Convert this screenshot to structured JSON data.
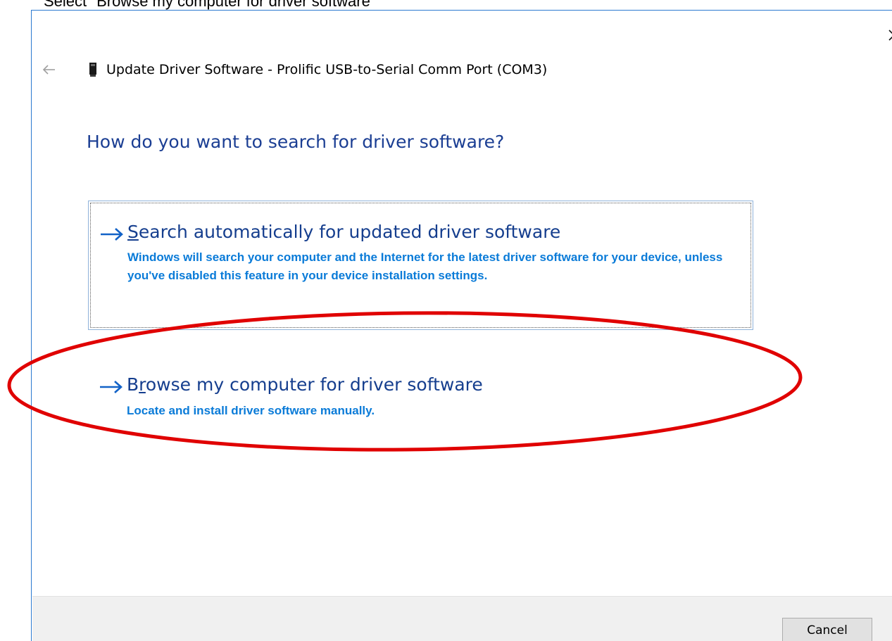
{
  "caption": {
    "text": "Select \"Browse my computer for driver software\""
  },
  "dialog": {
    "title": "Update Driver Software - Prolific USB-to-Serial Comm Port (COM3)",
    "question": "How do you want to search for driver software?",
    "options": [
      {
        "title_accesskey": "S",
        "title_rest": "earch automatically for updated driver software",
        "description": "Windows will search your computer and the Internet for the latest driver software for your device, unless you've disabled this feature in your device installation settings."
      },
      {
        "title_prefix": "B",
        "title_accesskey": "r",
        "title_rest": "owse my computer for driver software",
        "description": "Locate and install driver software manually."
      }
    ],
    "cancel_label": "Cancel"
  },
  "icons": {
    "close": "close-icon",
    "back": "back-arrow-icon",
    "device": "usb-device-icon",
    "option_arrow": "right-arrow-icon"
  },
  "colors": {
    "accent_border": "#2b79d0",
    "heading": "#1b3e93",
    "link_title": "#153e8e",
    "link_desc": "#0a7bd8",
    "annotation": "#e00000",
    "footer_bg": "#f0f0f0"
  }
}
